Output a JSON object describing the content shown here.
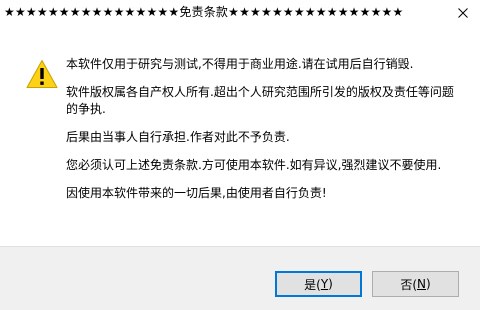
{
  "window": {
    "title": "★★★★★★★★★★★★★★★★免责条款★★★★★★★★★★★★★★★★",
    "close_glyph": "✕"
  },
  "icon": {
    "name": "warning-icon",
    "color": "#fcd116",
    "mark": "!"
  },
  "message": {
    "paragraphs": [
      "本软件仅用于研究与测试,不得用于商业用途.请在试用后自行销毁.",
      "软件版权属各自产权人所有.超出个人研究范围所引发的版权及责任等问题的争执.",
      "后果由当事人自行承担.作者对此不予负责.",
      "您必须认可上述免责条款.方可使用本软件.如有异议,强烈建议不要使用.",
      "因使用本软件带来的一切后果,由使用者自行负责!"
    ]
  },
  "buttons": {
    "yes": {
      "text": "是(",
      "key": "Y",
      "close": ")"
    },
    "no": {
      "text": "否(",
      "key": "N",
      "close": ")"
    }
  },
  "colors": {
    "footer": "#f0f0f0",
    "focus_border": "#0078d7"
  }
}
